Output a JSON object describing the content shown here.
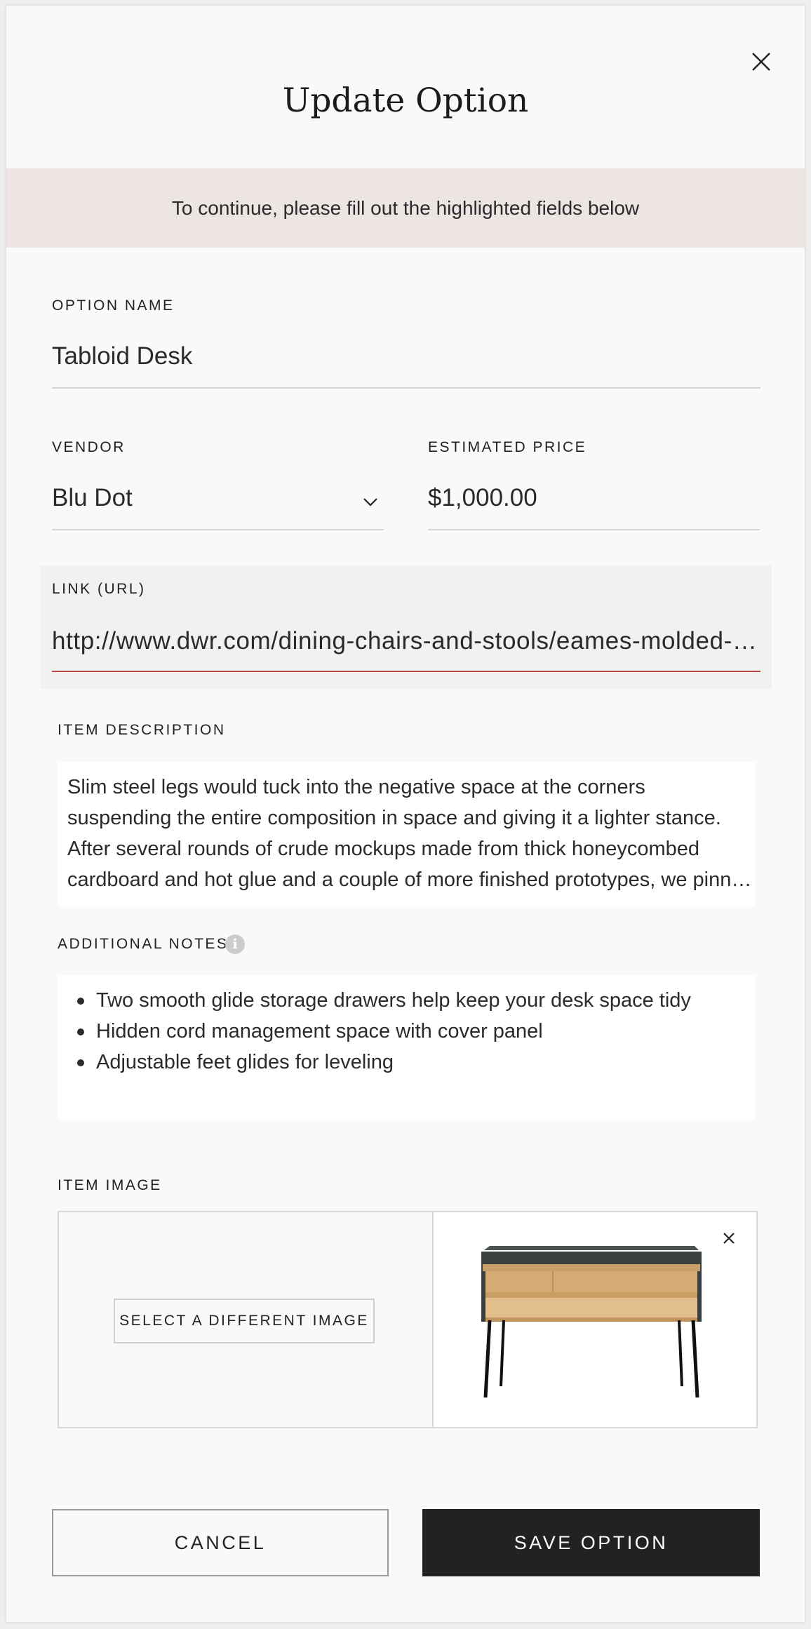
{
  "modal": {
    "title": "Update Option",
    "close_icon": "close-icon",
    "alert_message": "To continue, please fill out the highlighted fields below"
  },
  "form": {
    "option_name": {
      "label": "OPTION NAME",
      "value": "Tabloid Desk"
    },
    "vendor": {
      "label": "VENDOR",
      "value": "Blu Dot",
      "icon": "chevron-down-icon"
    },
    "estimated_price": {
      "label": "ESTIMATED PRICE",
      "value": "$1,000.00"
    },
    "link": {
      "label": "LINK (URL)",
      "value": "http://www.dwr.com/dining-chairs-and-stools/eames-molded-plastic-side-chair"
    },
    "item_description": {
      "label": "ITEM DESCRIPTION",
      "lines": [
        "Slim steel legs would tuck into the negative space at the corners",
        "suspending the entire composition in space and giving it a lighter stance.",
        "After several rounds of crude mockups made from thick honeycombed",
        "cardboard and hot glue and a couple of more finished prototypes, we pinned down the final form."
      ]
    },
    "additional_notes": {
      "label": "ADDITIONAL NOTES",
      "info_icon": "info-icon",
      "info_glyph": "i",
      "items": [
        "Two smooth glide storage drawers help keep your desk space tidy",
        "Hidden cord management space with cover panel",
        "Adjustable feet glides for leveling"
      ]
    },
    "item_image": {
      "label": "ITEM IMAGE",
      "select_button": "SELECT A DIFFERENT IMAGE",
      "remove_icon": "close-icon"
    }
  },
  "actions": {
    "cancel": "CANCEL",
    "save": "SAVE OPTION"
  },
  "colors": {
    "alert_background": "#ece5e3",
    "error_underline": "#b8474a",
    "primary_button": "#222222"
  }
}
